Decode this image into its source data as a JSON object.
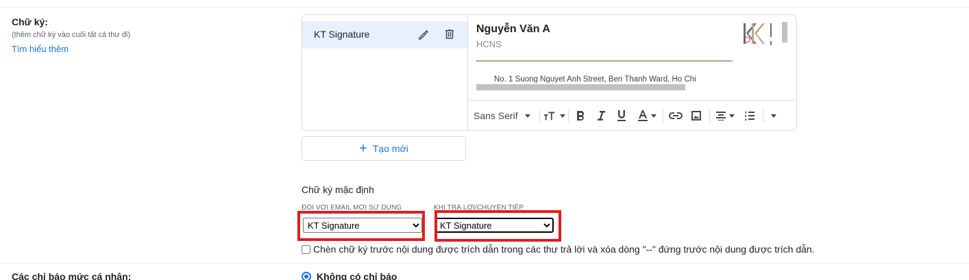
{
  "signature_setting": {
    "title": "Chữ ký:",
    "description": "(thêm chữ ký vào cuối tất cả thư đi)",
    "learn_more": "Tìm hiểu thêm"
  },
  "signatures": {
    "items": [
      {
        "label": "KT Signature"
      }
    ]
  },
  "preview": {
    "name": "Nguyễn Văn A",
    "department": "HCNS",
    "address": "No. 1 Suong Nguyet Anh Street, Ben Thanh Ward, Ho Chi"
  },
  "toolbar": {
    "font": "Sans Serif"
  },
  "create_button": {
    "label": "Tạo mới"
  },
  "defaults": {
    "title": "Chữ ký mặc định",
    "new_email_label": "ĐỐI VỚI EMAIL MỚI SỬ DỤNG",
    "reply_label": "KHI TRẢ LỜI/CHUYỂN TIẾP",
    "new_email_value": "KT Signature",
    "reply_value": "KT Signature"
  },
  "insert_before_quote": {
    "label": "Chèn chữ ký trước nội dung được trích dẫn trong các thư trả lời và xóa dòng \"--\" đứng trước nội dung được trích dẫn.",
    "checked": false
  },
  "personal_indicators": {
    "title": "Các chỉ báo mức cá nhân:",
    "option": "Không có chỉ báo"
  },
  "colors": {
    "accent": "#1a73e8",
    "selected_bg": "#e8f0fe",
    "highlight": "#e01e1e"
  }
}
